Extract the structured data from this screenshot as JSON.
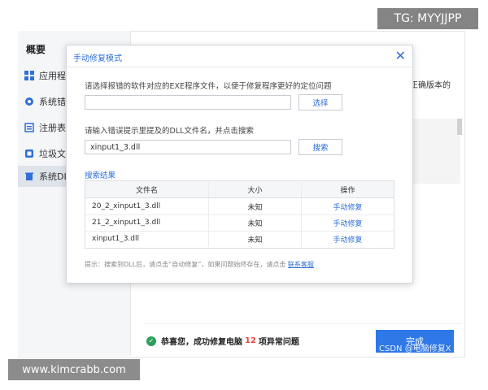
{
  "sidebar": {
    "title": "概要",
    "items": [
      {
        "label": "应用程序",
        "icon": "grid-icon"
      },
      {
        "label": "系统错误",
        "icon": "gear-icon"
      },
      {
        "label": "注册表错",
        "icon": "registry-icon"
      },
      {
        "label": "垃圾文件",
        "icon": "junk-icon"
      },
      {
        "label": "系统DLL",
        "icon": "trash-icon",
        "active": true
      }
    ]
  },
  "background": {
    "right_text": "正确版本的"
  },
  "dialog": {
    "title": "手动修复模式",
    "exe_prompt": "请选择报错的软件对应的EXE程序文件，以便于修复程序更好的定位问题",
    "exe_input_value": "",
    "choose_button": "选择",
    "dll_prompt": "请输入错误提示里提及的DLL文件名，并点击搜索",
    "dll_input_value": "xinput1_3.dll",
    "search_button": "搜索",
    "results_title": "搜索结果",
    "columns": [
      "文件名",
      "大小",
      "操作"
    ],
    "rows": [
      {
        "name": "20_2_xinput1_3.dll",
        "size": "未知",
        "action": "手动修复"
      },
      {
        "name": "21_2_xinput1_3.dll",
        "size": "未知",
        "action": "手动修复"
      },
      {
        "name": "xinput1_3.dll",
        "size": "未知",
        "action": "手动修复"
      }
    ],
    "tip_text": "提示：搜索到DLL后，请点击“自动修复”，如果问题始终存在，请点击",
    "tip_link": "联系客服"
  },
  "footer": {
    "status_prefix": "恭喜您，成功修复电脑",
    "status_count": "12",
    "status_suffix": "项异常问题",
    "done_button": "完成"
  },
  "watermarks": {
    "top": "TG: MYYJJPP",
    "bottom": "www.kimcrabb.com",
    "csdn": "CSDN @电脑修复X"
  },
  "colors": {
    "accent": "#2f6fd8",
    "button": "#2f78e8",
    "success": "#2aa05a",
    "count": "#e0463a"
  }
}
